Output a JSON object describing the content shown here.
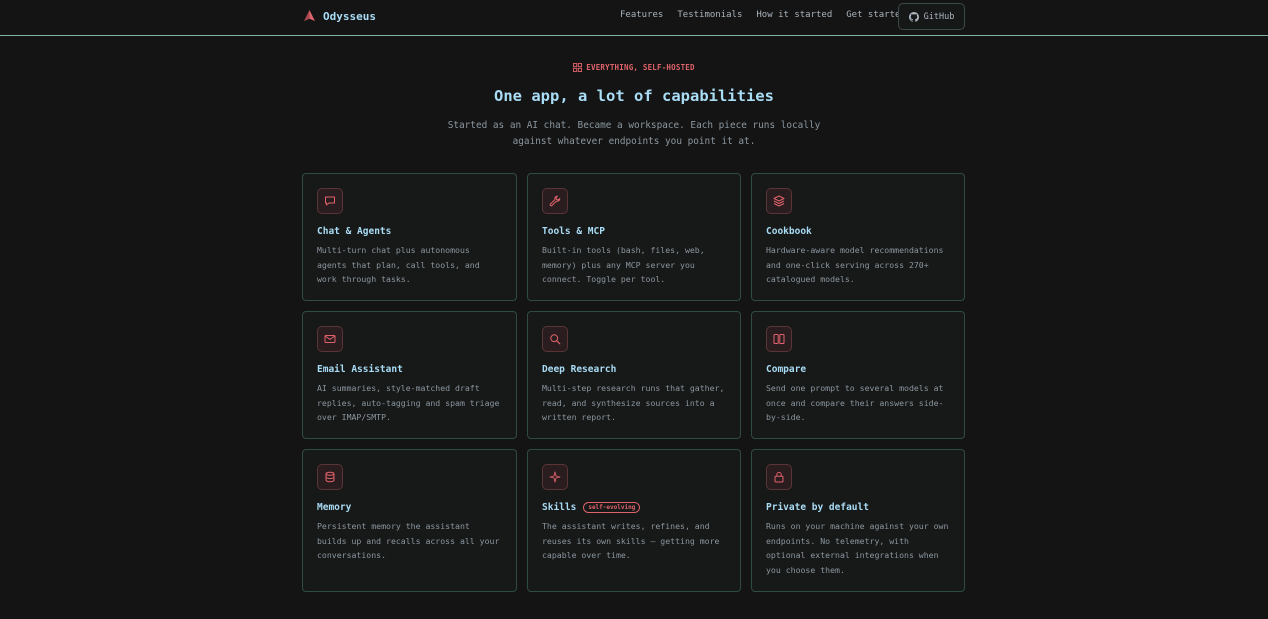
{
  "brand": {
    "name": "Odysseus",
    "logo_icon": "odysseus-sail-logo",
    "accent": "#e0636b"
  },
  "nav": {
    "links": [
      {
        "label": "Features"
      },
      {
        "label": "Testimonials"
      },
      {
        "label": "How it started"
      },
      {
        "label": "Get started"
      }
    ],
    "github": {
      "label": "GitHub",
      "icon": "github-icon"
    }
  },
  "hero": {
    "eyebrow": "EVERYTHING, SELF-HOSTED",
    "eyebrow_icon": "grid-icon",
    "heading": "One app, a lot of capabilities",
    "subtitle": "Started as an AI chat. Became a workspace. Each piece runs locally against whatever endpoints you point it at."
  },
  "features": [
    {
      "icon": "chat-bubble-icon",
      "title": "Chat & Agents",
      "description": "Multi-turn chat plus autonomous agents that plan, call tools, and work through tasks."
    },
    {
      "icon": "wrench-icon",
      "title": "Tools & MCP",
      "description": "Built-in tools (bash, files, web, memory) plus any MCP server you connect. Toggle per tool."
    },
    {
      "icon": "layers-icon",
      "title": "Cookbook",
      "description": "Hardware-aware model recommendations and one-click serving across 270+ catalogued models."
    },
    {
      "icon": "mail-icon",
      "title": "Email Assistant",
      "description": "AI summaries, style-matched draft replies, auto-tagging and spam triage over IMAP/SMTP."
    },
    {
      "icon": "search-icon",
      "title": "Deep Research",
      "description": "Multi-step research runs that gather, read, and synthesize sources into a written report."
    },
    {
      "icon": "columns-icon",
      "title": "Compare",
      "description": "Send one prompt to several models at once and compare their answers side-by-side."
    },
    {
      "icon": "database-icon",
      "title": "Memory",
      "description": "Persistent memory the assistant builds up and recalls across all your conversations."
    },
    {
      "icon": "sparkle-icon",
      "title": "Skills",
      "badge": "self-evolving",
      "description": "The assistant writes, refines, and reuses its own skills — getting more capable over time."
    },
    {
      "icon": "lock-icon",
      "title": "Private by default",
      "description": "Runs on your machine against your own endpoints. No telemetry, with optional external integrations when you choose them."
    }
  ]
}
